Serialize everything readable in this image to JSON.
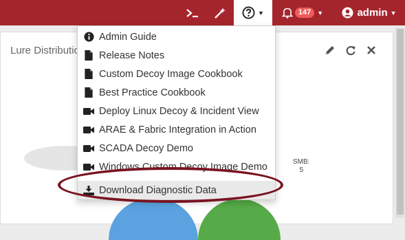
{
  "colors": {
    "topbar": "#a5252c",
    "badge": "#ef5a5a",
    "annotation": "#7a1420",
    "pie_blue": "#5aa3e0",
    "pie_green": "#56ab48"
  },
  "topbar": {
    "icons": [
      "terminal-icon",
      "magic-wand-icon",
      "help-icon",
      "bell-icon",
      "user-icon"
    ],
    "notifications_count": "147",
    "user_label": "admin"
  },
  "panel": {
    "title": "Lure Distribution",
    "smb_label": "SMB:",
    "smb_value": "5"
  },
  "help_menu": {
    "items": [
      {
        "label": "Admin Guide",
        "icon": "info-icon"
      },
      {
        "label": "Release Notes",
        "icon": "document-icon"
      },
      {
        "label": "Custom Decoy Image Cookbook",
        "icon": "document-icon"
      },
      {
        "label": "Best Practice Cookbook",
        "icon": "document-icon"
      },
      {
        "label": "Deploy Linux Decoy & Incident View",
        "icon": "video-icon"
      },
      {
        "label": "ARAE & Fabric Integration in Action",
        "icon": "video-icon"
      },
      {
        "label": "SCADA Decoy Demo",
        "icon": "video-icon"
      },
      {
        "label": "Windows Custom Decoy Image Demo",
        "icon": "video-icon"
      }
    ],
    "download_label": "Download Diagnostic Data"
  }
}
